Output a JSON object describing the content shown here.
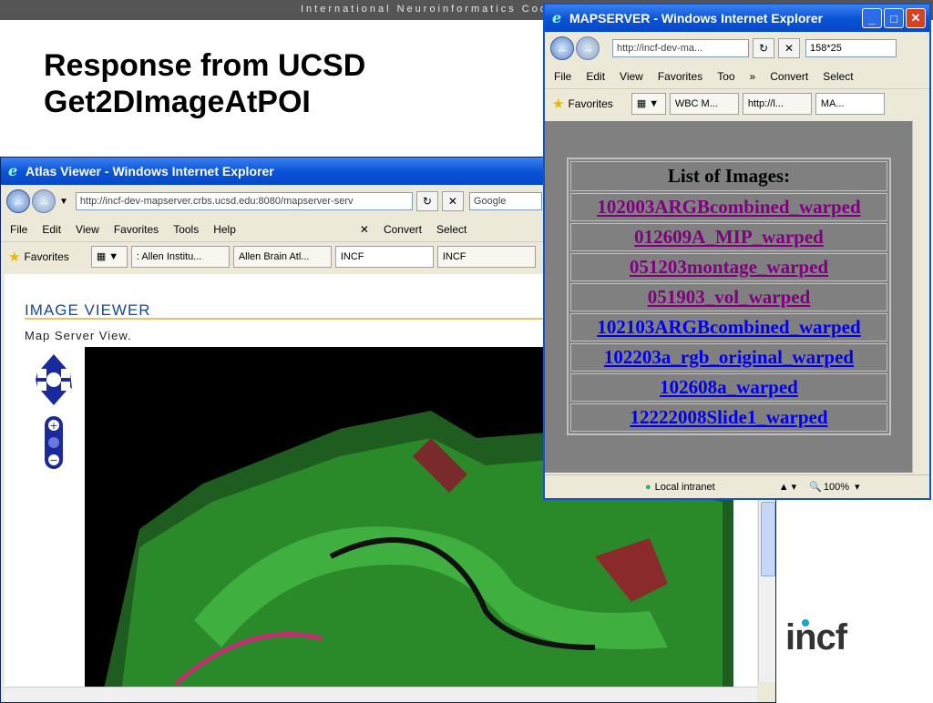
{
  "slide": {
    "topbar_text": "International Neuroinformatics Coordina",
    "title_line1": "Response from UCSD",
    "title_line2": "Get2DImageAtPOI",
    "logo_text": "incf"
  },
  "atlas_window": {
    "title": "Atlas Viewer - Windows Internet Explorer",
    "address": "http://incf-dev-mapserver.crbs.ucsd.edu:8080/mapserver-serv",
    "search_placeholder": "Google",
    "menu": [
      "File",
      "Edit",
      "View",
      "Favorites",
      "Tools",
      "Help"
    ],
    "toolbar": {
      "convert": "Convert",
      "select": "Select"
    },
    "favorites_label": "Favorites",
    "tabs": [
      ": Allen Institu...",
      "Allen Brain Atl...",
      "INCF",
      "INCF"
    ],
    "page": {
      "heading": "IMAGE VIEWER",
      "subheading": "Map Server View."
    }
  },
  "mapserver_window": {
    "title": "MAPSERVER - Windows Internet Explorer",
    "address": "http://incf-dev-ma...",
    "search_value": "158*25",
    "menu": [
      "File",
      "Edit",
      "View",
      "Favorites",
      "Too"
    ],
    "toolbar": {
      "convert": "Convert",
      "select": "Select"
    },
    "favorites_label": "Favorites",
    "tabs": [
      "WBC M...",
      "http://l...",
      "MA..."
    ],
    "list_heading": "List of Images:",
    "images": [
      {
        "name": "102003ARGBcombined_warped",
        "visited": true
      },
      {
        "name": "012609A_MIP_warped",
        "visited": true
      },
      {
        "name": "051203montage_warped",
        "visited": true
      },
      {
        "name": "051903_vol_warped",
        "visited": true
      },
      {
        "name": "102103ARGBcombined_warped",
        "visited": false
      },
      {
        "name": "102203a_rgb_original_warped",
        "visited": false
      },
      {
        "name": "102608a_warped",
        "visited": false
      },
      {
        "name": "12222008Slide1_warped",
        "visited": false
      }
    ],
    "status": {
      "zone": "Local intranet",
      "zoom": "100%"
    }
  },
  "colors": {
    "visited_link": "#800080",
    "unvisited_link": "#0000ee",
    "titlebar": "#0a54d8",
    "content_gray": "#808080"
  }
}
